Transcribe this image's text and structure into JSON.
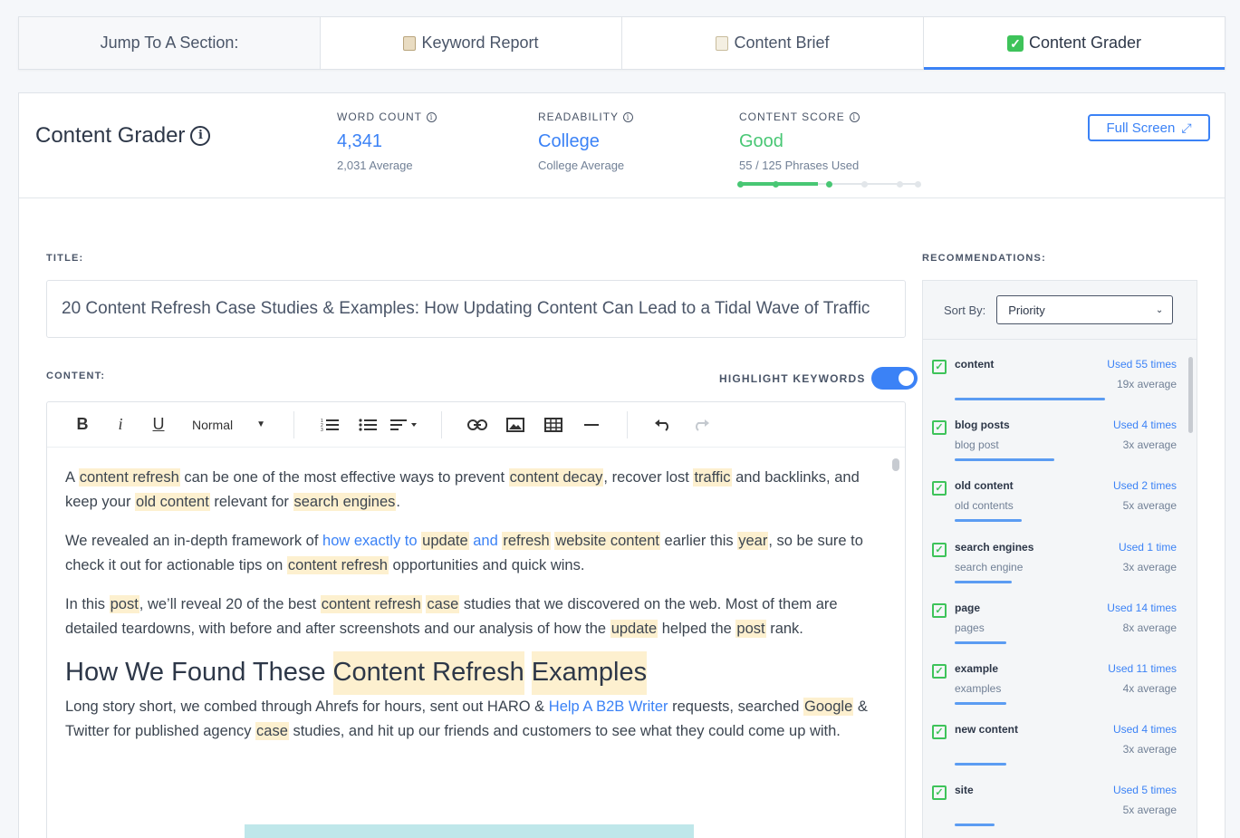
{
  "tabs": {
    "jump_label": "Jump To A Section:",
    "keyword_report": "Keyword Report",
    "content_brief": "Content Brief",
    "content_grader": "Content Grader"
  },
  "header": {
    "title": "Content Grader",
    "word_count": {
      "label": "WORD COUNT",
      "value": "4,341",
      "sub": "2,031 Average"
    },
    "readability": {
      "label": "READABILITY",
      "value": "College",
      "sub": "College Average"
    },
    "content_score": {
      "label": "CONTENT SCORE",
      "value": "Good",
      "sub": "55 / 125 Phrases Used",
      "progress_fraction": 0.44
    },
    "full_screen_label": "Full Screen"
  },
  "title_section": {
    "label": "TITLE:",
    "value": "20 Content Refresh Case Studies & Examples: How Updating Content Can Lead to a Tidal Wave of Traffic"
  },
  "content_section": {
    "label": "CONTENT:",
    "highlight_label": "HIGHLIGHT KEYWORDS",
    "highlight_on": true,
    "format_select": "Normal"
  },
  "recommendations": {
    "label": "RECOMMENDATIONS:",
    "sort_label": "Sort By:",
    "sort_value": "Priority",
    "items": [
      {
        "name": "content",
        "alt": "",
        "used": "Used 55 times",
        "avg": "19x average",
        "fill": 0.9
      },
      {
        "name": "blog posts",
        "alt": "blog post",
        "used": "Used 4 times",
        "avg": "3x average",
        "fill": 0.6
      },
      {
        "name": "old content",
        "alt": "old contents",
        "used": "Used 2 times",
        "avg": "5x average",
        "fill": 0.4
      },
      {
        "name": "search engines",
        "alt": "search engine",
        "used": "Used 1 time",
        "avg": "3x average",
        "fill": 0.34
      },
      {
        "name": "page",
        "alt": "pages",
        "used": "Used 14 times",
        "avg": "8x average",
        "fill": 0.31
      },
      {
        "name": "example",
        "alt": "examples",
        "used": "Used 11 times",
        "avg": "4x average",
        "fill": 0.31
      },
      {
        "name": "new content",
        "alt": "",
        "used": "Used 4 times",
        "avg": "3x average",
        "fill": 0.31
      },
      {
        "name": "site",
        "alt": "",
        "used": "Used 5 times",
        "avg": "5x average",
        "fill": 0.24
      }
    ]
  }
}
